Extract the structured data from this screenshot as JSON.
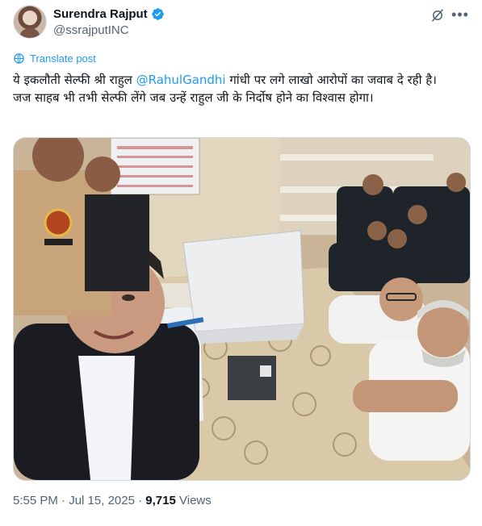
{
  "author": {
    "display_name": "Surendra Rajput",
    "handle": "@ssrajputINC",
    "verified": true,
    "avatar_icon": "profile-photo-avatar"
  },
  "header_icons": {
    "grok": "grok-slash-icon",
    "more": "more-horizontal-icon"
  },
  "translate_label": "Translate post",
  "tweet": {
    "line1_pre": "ये इकलौती सेल्फी श्री राहुल ",
    "mention": "@RahulGandhi",
    "line1_post": " गांधी पर लगे लाखो आरोपों का जवाब दे रही है।",
    "line2": "जज साहब भी तभी सेल्फी लेंगे जब उन्हें राहुल जी के निर्दोष होने का विश्वास होगा।"
  },
  "meta": {
    "time": "5:55 PM",
    "separator": " · ",
    "date": "Jul 15, 2025",
    "views_count": "9,715",
    "views_label": " Views"
  },
  "colors": {
    "link": "#1d9bf0",
    "text": "#0f1419",
    "secondary": "#536471",
    "verified": "#1d9bf0"
  }
}
